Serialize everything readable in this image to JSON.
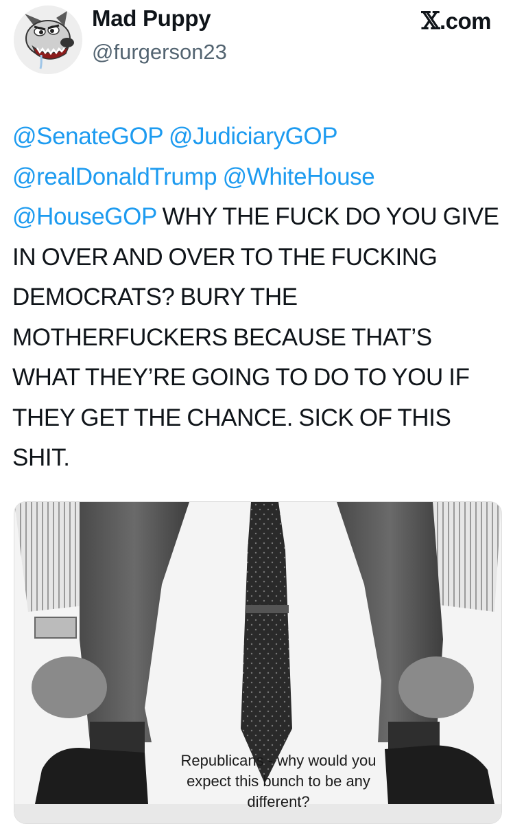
{
  "author": {
    "display_name": "Mad Puppy",
    "handle": "@furgerson23",
    "avatar_icon": "cartoon-dog-avatar-icon"
  },
  "brand": {
    "label": ".com",
    "logo_glyph": "𝕏",
    "logo_icon": "x-logo-icon"
  },
  "tweet": {
    "mentions": [
      "@SenateGOP",
      "@JudiciaryGOP",
      "@realDonaldTrump",
      "@WhiteHouse",
      "@HouseGOP"
    ],
    "body": "WHY THE FUCK DO YOU GIVE IN OVER AND OVER TO THE FUCKING DEMOCRATS? BURY THE MOTHERFUCKERS BECAUSE THAT’S WHAT THEY’RE GOING TO DO TO YOU IF THEY GET THE CHANCE. SICK OF THIS SHIT."
  },
  "media": {
    "description_icon": "man-pulling-up-trouser-legs-image",
    "caption_lines": [
      "Republicans - why would you",
      "expect this bunch to be any",
      "different?"
    ]
  },
  "colors": {
    "mention": "#1d9bf0",
    "text": "#0f1419",
    "handle": "#536471"
  }
}
